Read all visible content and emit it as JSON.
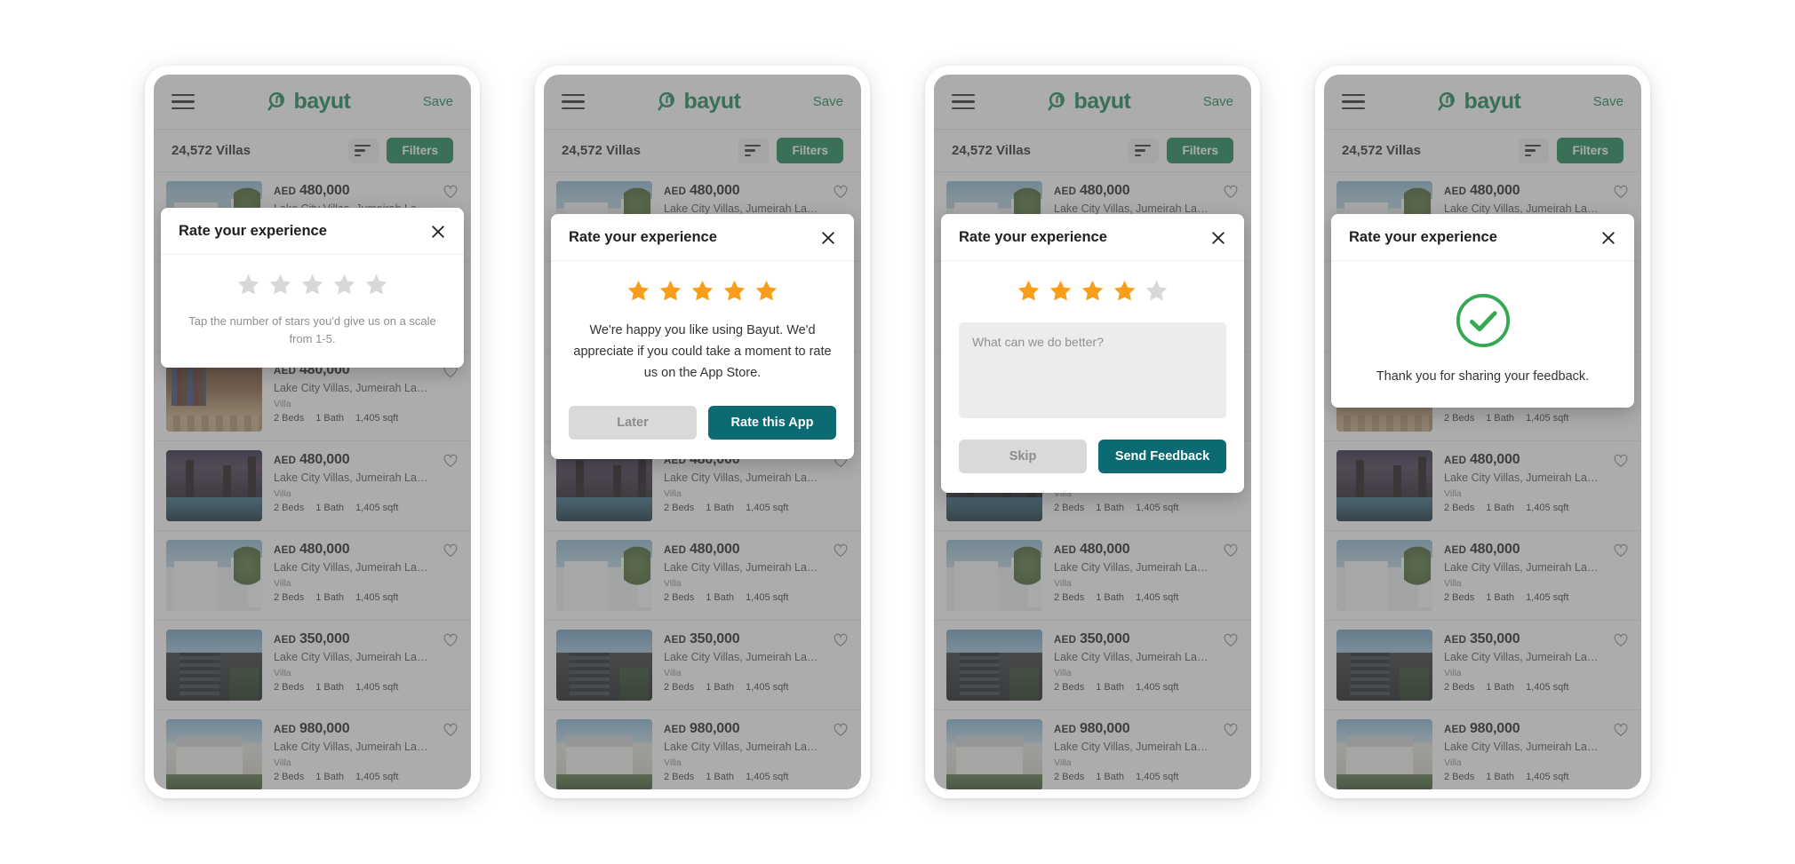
{
  "app": {
    "header": {
      "menu_icon": "hamburger-menu-icon",
      "brand": "bayut",
      "save_label": "Save"
    },
    "filter_bar": {
      "count": "24,572 Villas",
      "sort_icon": "sort-icon",
      "filters_label": "Filters"
    },
    "listings": [
      {
        "currency": "AED",
        "price": "480,000",
        "address": "Lake City Villas, Jumeirah Lake T...",
        "type": "Villa",
        "beds": "2 Beds",
        "baths": "1 Bath",
        "area": "1,405 sqft",
        "photo": "ph-white"
      },
      {
        "currency": "AED",
        "price": "480,000",
        "address": "Lake City Villas, Jumeirah Lake T...",
        "type": "Villa",
        "beds": "2 Beds",
        "baths": "1 Bath",
        "area": "1,405 sqft",
        "photo": "ph-modern"
      },
      {
        "currency": "AED",
        "price": "480,000",
        "address": "Lake City Villas, Jumeirah Lake T...",
        "type": "Villa",
        "beds": "2 Beds",
        "baths": "1 Bath",
        "area": "1,405 sqft",
        "photo": "ph-interior"
      },
      {
        "currency": "AED",
        "price": "480,000",
        "address": "Lake City Villas, Jumeirah Lake T...",
        "type": "Villa",
        "beds": "2 Beds",
        "baths": "1 Bath",
        "area": "1,405 sqft",
        "photo": "ph-resort"
      },
      {
        "currency": "AED",
        "price": "480,000",
        "address": "Lake City Villas, Jumeirah Lake T...",
        "type": "Villa",
        "beds": "2 Beds",
        "baths": "1 Bath",
        "area": "1,405 sqft",
        "photo": "ph-white"
      },
      {
        "currency": "AED",
        "price": "350,000",
        "address": "Lake City Villas, Jumeirah Lake T...",
        "type": "Villa",
        "beds": "2 Beds",
        "baths": "1 Bath",
        "area": "1,405 sqft",
        "photo": "ph-modern"
      },
      {
        "currency": "AED",
        "price": "980,000",
        "address": "Lake City Villas, Jumeirah Lake T...",
        "type": "Villa",
        "beds": "2 Beds",
        "baths": "1 Bath",
        "area": "1,405 sqft",
        "photo": "ph-house"
      }
    ]
  },
  "modal_title": "Rate your experience",
  "close_icon": "close-icon",
  "screens": [
    {
      "id": "empty-rating",
      "stars_filled": 0,
      "stars_total": 5,
      "hint": "Tap the number of stars you'd give us on a scale from 1-5."
    },
    {
      "id": "five-star-praise",
      "stars_filled": 5,
      "stars_total": 5,
      "message": "We're happy you like using Bayut. We'd appreciate if you could take a moment to rate us on the App Store.",
      "secondary_button": "Later",
      "primary_button": "Rate this App"
    },
    {
      "id": "four-star-feedback",
      "stars_filled": 4,
      "stars_total": 5,
      "feedback_placeholder": "What can we do better?",
      "secondary_button": "Skip",
      "primary_button": "Send Feedback"
    },
    {
      "id": "thank-you",
      "success_icon": "circle-check-icon",
      "thanks": "Thank you for sharing your feedback."
    }
  ],
  "colors": {
    "brand_green": "#198754",
    "star_filled": "#F89E1B",
    "star_empty": "#D8D8D8",
    "primary_button": "#0B6A72",
    "success_green": "#34A853"
  }
}
